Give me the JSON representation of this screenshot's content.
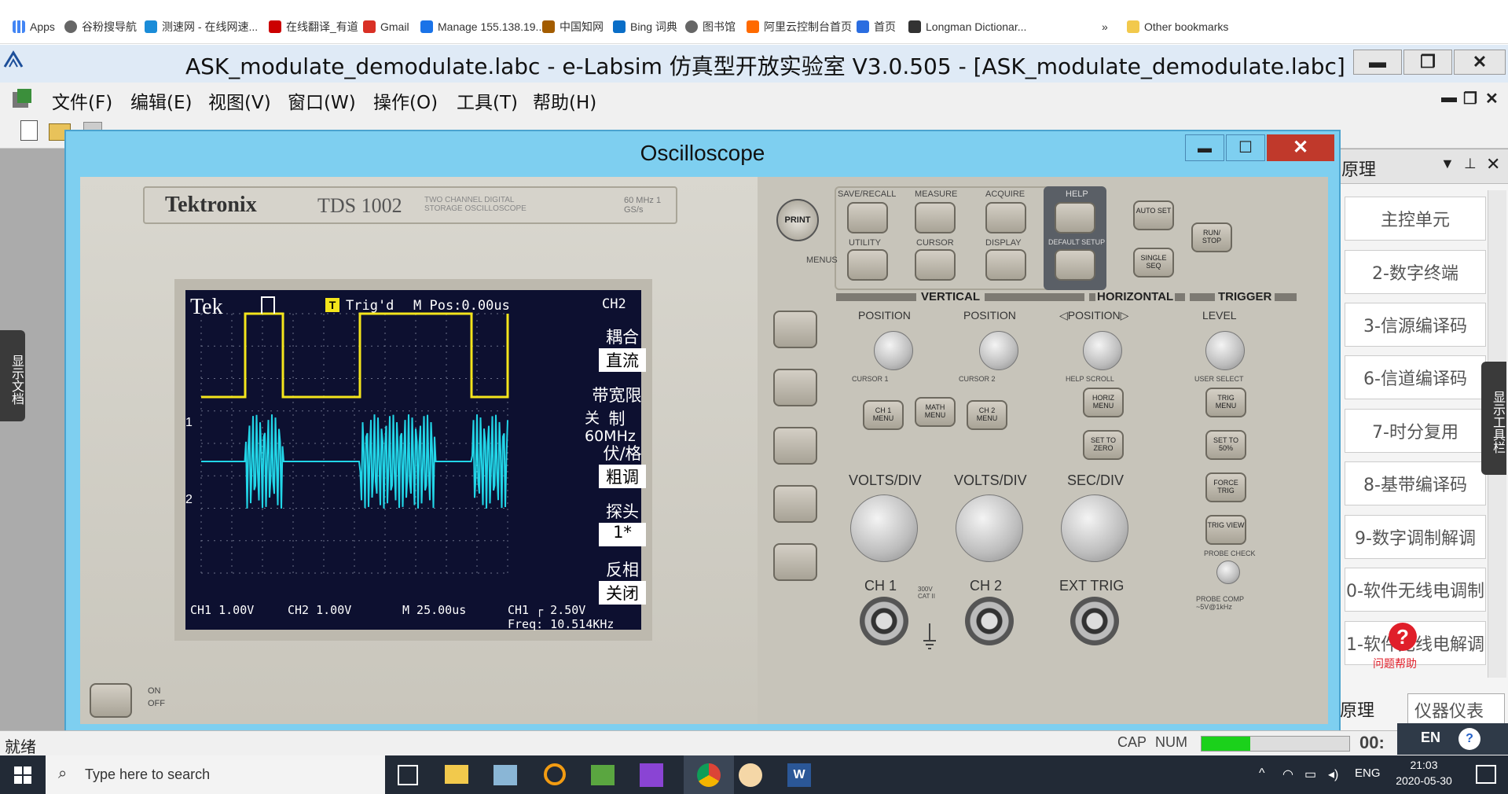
{
  "bookmarks": [
    {
      "label": "Apps",
      "color": "#4285f4"
    },
    {
      "label": "谷粉搜导航",
      "color": "#555"
    },
    {
      "label": "测速网 - 在线网速...",
      "color": "#1a8cd8"
    },
    {
      "label": "在线翻译_有道",
      "color": "#c00"
    },
    {
      "label": "Gmail",
      "color": "#d93025"
    },
    {
      "label": "Manage 155.138.19...",
      "color": "#1a73e8"
    },
    {
      "label": "中国知网",
      "color": "#a35c00"
    },
    {
      "label": "Bing 词典",
      "color": "#0a6ec7"
    },
    {
      "label": "图书馆",
      "color": "#555"
    },
    {
      "label": "阿里云控制台首页",
      "color": "#ff6a00"
    },
    {
      "label": "首页",
      "color": "#2b6de0"
    },
    {
      "label": "Longman Dictionar...",
      "color": "#333"
    },
    {
      "label": "»",
      "color": "#555"
    },
    {
      "label": "Other bookmarks",
      "color": "#f2c94c"
    }
  ],
  "app": {
    "title": "ASK_modulate_demodulate.labc - e-Labsim 仿真型开放实验室 V3.0.505 - [ASK_modulate_demodulate.labc]",
    "min": "▬",
    "max": "❐",
    "close": "✕"
  },
  "menubar": [
    "文件(F)",
    "编辑(E)",
    "视图(V)",
    "窗口(W)",
    "操作(O)",
    "工具(T)",
    "帮助(H)"
  ],
  "mdi_controls": {
    "min": "▬",
    "restore": "❐",
    "close": "✕"
  },
  "left_tab": "显示文档",
  "right_tab": "显示工具栏",
  "right_panel": {
    "title": "原理",
    "items": [
      "主控单元",
      "2-数字终端",
      "3-信源编译码",
      "6-信道编译码",
      "7-时分复用",
      "8-基带编译码",
      "9-数字调制解调",
      "0-软件无线电调制",
      "1-软件无线电解调"
    ],
    "bottom_tabs": [
      "原理",
      "仪器仪表"
    ],
    "help_label": "问题帮助"
  },
  "oscilloscope": {
    "window_title": "Oscilloscope",
    "brand": "Tektronix",
    "model": "TDS 1002",
    "model_sub": "TWO CHANNEL DIGITAL STORAGE OSCILLOSCOPE",
    "spec": "60 MHz 1 GS/s",
    "screen": {
      "tek": "Tek",
      "trig_status": "Trig'd",
      "mpos": "M Pos:0.00us",
      "channel": "CH2",
      "menu": [
        {
          "head": "耦合",
          "value": "直流"
        },
        {
          "head": "带宽限制",
          "value": "关 60MHz"
        },
        {
          "head": "伏/格",
          "value": "粗调"
        },
        {
          "head": "探头",
          "value": "1*"
        },
        {
          "head": "反相",
          "value": "关闭"
        }
      ],
      "ch1_scale": "CH1 1.00V",
      "ch2_scale": "CH2 1.00V",
      "time_scale": "M 25.00us",
      "trigger": "CH1 ┌ 2.50V",
      "freq": "Freq: 10.514KHz",
      "ch1_marker": "1",
      "ch2_marker": "2"
    },
    "buttons": {
      "print": "PRINT",
      "save_recall": "SAVE/RECALL",
      "measure": "MEASURE",
      "acquire": "ACQUIRE",
      "help": "HELP",
      "utility": "UTILITY",
      "cursor": "CURSOR",
      "display": "DISPLAY",
      "default_setup": "DEFAULT SETUP",
      "menus": "MENUS",
      "auto_set": "AUTO SET",
      "single_seq": "SINGLE SEQ",
      "run_stop": "RUN/ STOP",
      "ch1_menu": "CH 1 MENU",
      "math_menu": "MATH MENU",
      "ch2_menu": "CH 2 MENU",
      "horiz_menu": "HORIZ MENU",
      "set_to_zero": "SET TO ZERO",
      "trig_menu": "TRIG MENU",
      "set_to_50": "SET TO 50%",
      "force_trig": "FORCE TRIG",
      "trig_view": "TRIG VIEW",
      "probe_check": "PROBE CHECK",
      "probe_comp": "PROBE COMP ~5V@1kHz",
      "on": "ON",
      "off": "OFF"
    },
    "sections": {
      "vertical": "VERTICAL",
      "horizontal": "HORIZONTAL",
      "trigger": "TRIGGER"
    },
    "labels": {
      "position1": "POSITION",
      "position2": "POSITION",
      "hposition": "◁POSITION▷",
      "level": "LEVEL",
      "cursor1": "CURSOR 1",
      "cursor2": "CURSOR 2",
      "help_scroll": "HELP SCROLL",
      "user_select": "USER SELECT",
      "volts_div1": "VOLTS/DIV",
      "volts_div2": "VOLTS/DIV",
      "sec_div": "SEC/DIV",
      "ch1": "CH 1",
      "ch2": "CH 2",
      "ext_trig": "EXT TRIG",
      "cat": "300V CAT II"
    },
    "window_controls": {
      "min": "▬",
      "max": "☐",
      "close": "✕"
    }
  },
  "status": {
    "text": "就绪",
    "caps": "CAP",
    "num": "NUM",
    "time_frag": "00:",
    "progress": 0.33
  },
  "taskbar": {
    "search_placeholder": "Type here to search",
    "lang": "ENG",
    "time": "21:03",
    "date": "2020-05-30",
    "ime": "EN"
  },
  "colors": {
    "ch1": "#f4e51b",
    "ch2": "#22d6e8",
    "screen_bg": "#0d1030"
  }
}
